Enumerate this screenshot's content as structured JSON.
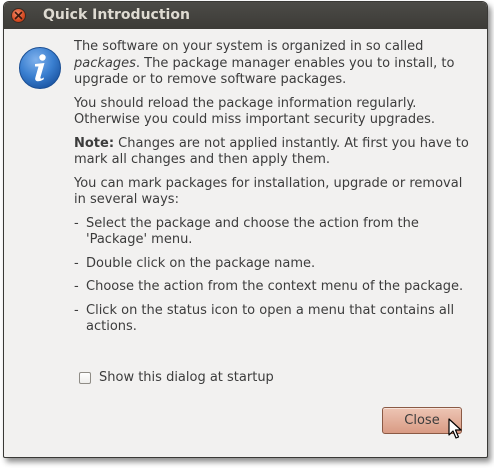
{
  "window": {
    "title": "Quick Introduction"
  },
  "content": {
    "p1_pre": "The software on your system is organized in so called ",
    "p1_em": "packages",
    "p1_post": ". The package manager enables you to install, to upgrade or to remove software packages.",
    "p2": "You should reload the package information regularly. Otherwise you could miss important security upgrades.",
    "p3_bold": "Note:",
    "p3_rest": " Changes are not applied instantly. At first you have to mark all changes and then apply them.",
    "p4": "You can mark packages for installation, upgrade or removal in several ways:",
    "list": [
      "Select the package and choose the action from the 'Package' menu.",
      "Double click on the package name.",
      "Choose the action from the context menu of the package.",
      "Click on the status icon to open a menu that contains all actions."
    ],
    "dash": "-"
  },
  "checkbox": {
    "label": "Show this dialog at startup",
    "checked": false
  },
  "buttons": {
    "close_label": "Close"
  },
  "icons": {
    "info": "info-icon",
    "window_close": "window-close-icon"
  },
  "colors": {
    "titlebar": "#3c3b37",
    "window_bg": "#f2f1f0",
    "close_accent": "#d74a22",
    "button_accent": "#d99b84",
    "info_blue": "#2a6cc0"
  }
}
